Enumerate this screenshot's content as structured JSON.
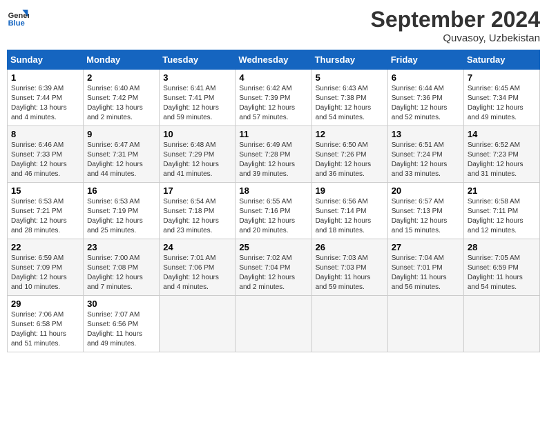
{
  "header": {
    "logo_line1": "General",
    "logo_line2": "Blue",
    "month_title": "September 2024",
    "subtitle": "Quvasoy, Uzbekistan"
  },
  "days_of_week": [
    "Sunday",
    "Monday",
    "Tuesday",
    "Wednesday",
    "Thursday",
    "Friday",
    "Saturday"
  ],
  "weeks": [
    [
      {
        "day": "1",
        "sunrise": "Sunrise: 6:39 AM",
        "sunset": "Sunset: 7:44 PM",
        "daylight": "Daylight: 13 hours and 4 minutes."
      },
      {
        "day": "2",
        "sunrise": "Sunrise: 6:40 AM",
        "sunset": "Sunset: 7:42 PM",
        "daylight": "Daylight: 13 hours and 2 minutes."
      },
      {
        "day": "3",
        "sunrise": "Sunrise: 6:41 AM",
        "sunset": "Sunset: 7:41 PM",
        "daylight": "Daylight: 12 hours and 59 minutes."
      },
      {
        "day": "4",
        "sunrise": "Sunrise: 6:42 AM",
        "sunset": "Sunset: 7:39 PM",
        "daylight": "Daylight: 12 hours and 57 minutes."
      },
      {
        "day": "5",
        "sunrise": "Sunrise: 6:43 AM",
        "sunset": "Sunset: 7:38 PM",
        "daylight": "Daylight: 12 hours and 54 minutes."
      },
      {
        "day": "6",
        "sunrise": "Sunrise: 6:44 AM",
        "sunset": "Sunset: 7:36 PM",
        "daylight": "Daylight: 12 hours and 52 minutes."
      },
      {
        "day": "7",
        "sunrise": "Sunrise: 6:45 AM",
        "sunset": "Sunset: 7:34 PM",
        "daylight": "Daylight: 12 hours and 49 minutes."
      }
    ],
    [
      {
        "day": "8",
        "sunrise": "Sunrise: 6:46 AM",
        "sunset": "Sunset: 7:33 PM",
        "daylight": "Daylight: 12 hours and 46 minutes."
      },
      {
        "day": "9",
        "sunrise": "Sunrise: 6:47 AM",
        "sunset": "Sunset: 7:31 PM",
        "daylight": "Daylight: 12 hours and 44 minutes."
      },
      {
        "day": "10",
        "sunrise": "Sunrise: 6:48 AM",
        "sunset": "Sunset: 7:29 PM",
        "daylight": "Daylight: 12 hours and 41 minutes."
      },
      {
        "day": "11",
        "sunrise": "Sunrise: 6:49 AM",
        "sunset": "Sunset: 7:28 PM",
        "daylight": "Daylight: 12 hours and 39 minutes."
      },
      {
        "day": "12",
        "sunrise": "Sunrise: 6:50 AM",
        "sunset": "Sunset: 7:26 PM",
        "daylight": "Daylight: 12 hours and 36 minutes."
      },
      {
        "day": "13",
        "sunrise": "Sunrise: 6:51 AM",
        "sunset": "Sunset: 7:24 PM",
        "daylight": "Daylight: 12 hours and 33 minutes."
      },
      {
        "day": "14",
        "sunrise": "Sunrise: 6:52 AM",
        "sunset": "Sunset: 7:23 PM",
        "daylight": "Daylight: 12 hours and 31 minutes."
      }
    ],
    [
      {
        "day": "15",
        "sunrise": "Sunrise: 6:53 AM",
        "sunset": "Sunset: 7:21 PM",
        "daylight": "Daylight: 12 hours and 28 minutes."
      },
      {
        "day": "16",
        "sunrise": "Sunrise: 6:53 AM",
        "sunset": "Sunset: 7:19 PM",
        "daylight": "Daylight: 12 hours and 25 minutes."
      },
      {
        "day": "17",
        "sunrise": "Sunrise: 6:54 AM",
        "sunset": "Sunset: 7:18 PM",
        "daylight": "Daylight: 12 hours and 23 minutes."
      },
      {
        "day": "18",
        "sunrise": "Sunrise: 6:55 AM",
        "sunset": "Sunset: 7:16 PM",
        "daylight": "Daylight: 12 hours and 20 minutes."
      },
      {
        "day": "19",
        "sunrise": "Sunrise: 6:56 AM",
        "sunset": "Sunset: 7:14 PM",
        "daylight": "Daylight: 12 hours and 18 minutes."
      },
      {
        "day": "20",
        "sunrise": "Sunrise: 6:57 AM",
        "sunset": "Sunset: 7:13 PM",
        "daylight": "Daylight: 12 hours and 15 minutes."
      },
      {
        "day": "21",
        "sunrise": "Sunrise: 6:58 AM",
        "sunset": "Sunset: 7:11 PM",
        "daylight": "Daylight: 12 hours and 12 minutes."
      }
    ],
    [
      {
        "day": "22",
        "sunrise": "Sunrise: 6:59 AM",
        "sunset": "Sunset: 7:09 PM",
        "daylight": "Daylight: 12 hours and 10 minutes."
      },
      {
        "day": "23",
        "sunrise": "Sunrise: 7:00 AM",
        "sunset": "Sunset: 7:08 PM",
        "daylight": "Daylight: 12 hours and 7 minutes."
      },
      {
        "day": "24",
        "sunrise": "Sunrise: 7:01 AM",
        "sunset": "Sunset: 7:06 PM",
        "daylight": "Daylight: 12 hours and 4 minutes."
      },
      {
        "day": "25",
        "sunrise": "Sunrise: 7:02 AM",
        "sunset": "Sunset: 7:04 PM",
        "daylight": "Daylight: 12 hours and 2 minutes."
      },
      {
        "day": "26",
        "sunrise": "Sunrise: 7:03 AM",
        "sunset": "Sunset: 7:03 PM",
        "daylight": "Daylight: 11 hours and 59 minutes."
      },
      {
        "day": "27",
        "sunrise": "Sunrise: 7:04 AM",
        "sunset": "Sunset: 7:01 PM",
        "daylight": "Daylight: 11 hours and 56 minutes."
      },
      {
        "day": "28",
        "sunrise": "Sunrise: 7:05 AM",
        "sunset": "Sunset: 6:59 PM",
        "daylight": "Daylight: 11 hours and 54 minutes."
      }
    ],
    [
      {
        "day": "29",
        "sunrise": "Sunrise: 7:06 AM",
        "sunset": "Sunset: 6:58 PM",
        "daylight": "Daylight: 11 hours and 51 minutes."
      },
      {
        "day": "30",
        "sunrise": "Sunrise: 7:07 AM",
        "sunset": "Sunset: 6:56 PM",
        "daylight": "Daylight: 11 hours and 49 minutes."
      },
      null,
      null,
      null,
      null,
      null
    ]
  ]
}
